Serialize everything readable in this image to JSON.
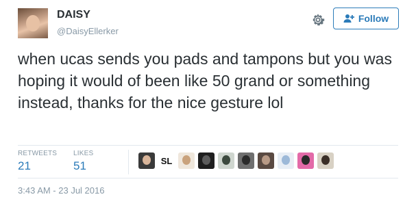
{
  "user": {
    "name": "DAISY",
    "handle": "@DaisyEllerker"
  },
  "actions": {
    "follow_label": "Follow"
  },
  "tweet": {
    "text": "when ucas sends you pads and tampons but you was hoping it would of been like 50 grand or something instead, thanks for the nice gesture lol",
    "timestamp": "3:43 AM - 23 Jul 2016"
  },
  "stats": {
    "retweets_label": "RETWEETS",
    "retweets_count": "21",
    "likes_label": "LIKES",
    "likes_count": "51"
  },
  "likers": [
    {
      "type": "photo",
      "bg": "#3a3a3a",
      "face": "#d9b59a"
    },
    {
      "type": "text",
      "label": "SL"
    },
    {
      "type": "photo",
      "bg": "#efe7dc",
      "face": "#c9a27c"
    },
    {
      "type": "photo",
      "bg": "#1f1f1f",
      "face": "#5c5c5c"
    },
    {
      "type": "photo",
      "bg": "#cfd6cf",
      "face": "#3d4a3f"
    },
    {
      "type": "photo",
      "bg": "#6f6f6f",
      "face": "#2a2a2a"
    },
    {
      "type": "photo",
      "bg": "#5a4a42",
      "face": "#b89a86"
    },
    {
      "type": "photo",
      "bg": "#e8eef5",
      "face": "#9db9d8"
    },
    {
      "type": "photo",
      "bg": "#e36aa8",
      "face": "#2a2a2a"
    },
    {
      "type": "photo",
      "bg": "#d8d1c4",
      "face": "#3b2f28"
    }
  ],
  "colors": {
    "accent": "#2b7bb9",
    "text": "#292f33",
    "muted": "#8899a6",
    "divider": "#e1e8ed"
  },
  "icons": {
    "gear": "gear-icon",
    "follow": "follow-user-plus-icon"
  }
}
